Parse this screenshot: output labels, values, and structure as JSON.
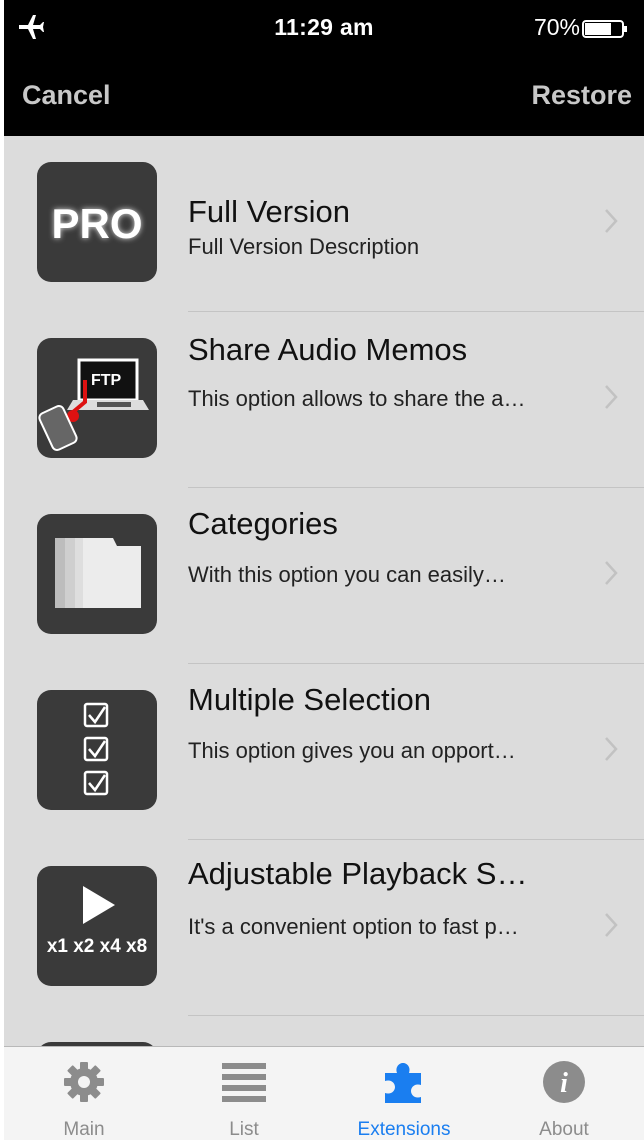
{
  "status_bar": {
    "time": "11:29 am",
    "battery": "70%"
  },
  "nav": {
    "left_button": "Cancel",
    "right_button": "Restore"
  },
  "items": [
    {
      "icon": "pro-badge-icon",
      "icon_text": "PRO",
      "title": "Full Version",
      "description": "Full Version Description"
    },
    {
      "icon": "ftp-share-icon",
      "icon_text": "FTP",
      "title": "Share Audio Memos",
      "description": "This option allows to share the a…"
    },
    {
      "icon": "folders-icon",
      "title": "Categories",
      "description": "With this option you can easily…"
    },
    {
      "icon": "checklist-icon",
      "title": "Multiple Selection",
      "description": "This option gives you an opport…"
    },
    {
      "icon": "play-speed-icon",
      "icon_text": "x1 x2 x4 x8",
      "title": "Adjustable Playback S…",
      "description": "It's a convenient option to fast p…"
    }
  ],
  "tabs": [
    {
      "label": "Main",
      "icon": "gear-icon"
    },
    {
      "label": "List",
      "icon": "list-icon"
    },
    {
      "label": "Extensions",
      "icon": "puzzle-icon",
      "active": true
    },
    {
      "label": "About",
      "icon": "info-icon"
    }
  ],
  "colors": {
    "accent": "#1a7ef0",
    "nav_bg": "#000000",
    "list_bg": "#dcdcdc",
    "icon_bg": "#3a3a3a"
  }
}
